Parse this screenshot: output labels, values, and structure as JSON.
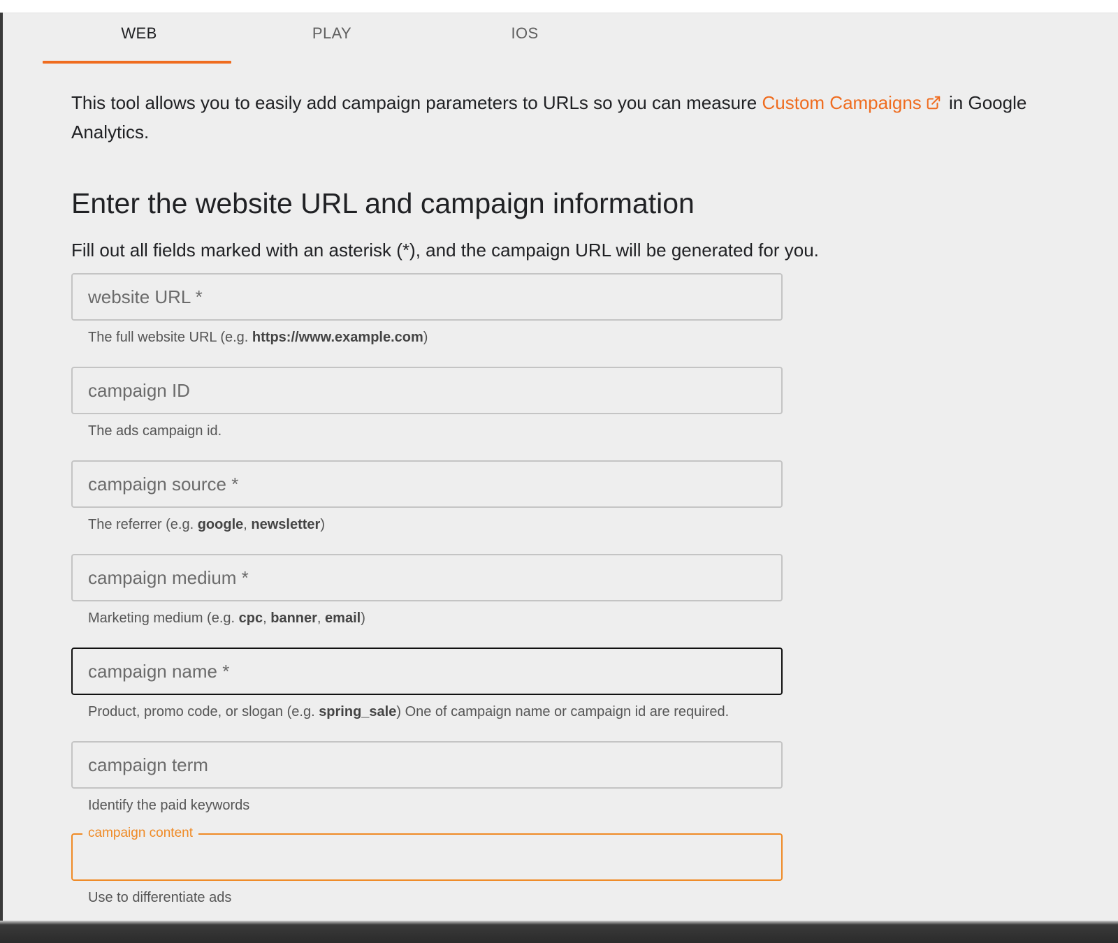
{
  "tabs": [
    {
      "label": "WEB",
      "active": true
    },
    {
      "label": "PLAY",
      "active": false
    },
    {
      "label": "IOS",
      "active": false
    }
  ],
  "intro": {
    "text_before": "This tool allows you to easily add campaign parameters to URLs so you can measure ",
    "link_text": "Custom Campaigns",
    "link_icon": "external-link-icon",
    "text_after": " in Google Analytics."
  },
  "heading": "Enter the website URL and campaign information",
  "subheading": "Fill out all fields marked with an asterisk (*), and the campaign URL will be generated for you.",
  "fields": {
    "website_url": {
      "placeholder": "website URL *",
      "value": "",
      "help_pre": "The full website URL (e.g. ",
      "help_bold": "https://www.example.com",
      "help_post": ")"
    },
    "campaign_id": {
      "placeholder": "campaign ID",
      "value": "",
      "help": "The ads campaign id."
    },
    "campaign_source": {
      "placeholder": "campaign source *",
      "value": "",
      "help_pre": "The referrer (e.g. ",
      "help_bold1": "google",
      "help_sep1": ", ",
      "help_bold2": "newsletter",
      "help_post": ")"
    },
    "campaign_medium": {
      "placeholder": "campaign medium *",
      "value": "",
      "help_pre": "Marketing medium (e.g. ",
      "help_bold1": "cpc",
      "help_sep1": ", ",
      "help_bold2": "banner",
      "help_sep2": ", ",
      "help_bold3": "email",
      "help_post": ")"
    },
    "campaign_name": {
      "placeholder": "campaign name *",
      "value": "",
      "help_pre": "Product, promo code, or slogan (e.g. ",
      "help_bold": "spring_sale",
      "help_post": ") One of campaign name or campaign id are required."
    },
    "campaign_term": {
      "placeholder": "campaign term",
      "value": "",
      "help": "Identify the paid keywords"
    },
    "campaign_content": {
      "label": "campaign content",
      "value": "",
      "help": "Use to differentiate ads"
    }
  },
  "colors": {
    "accent": "#ef6c1f",
    "focus_orange": "#ef8a25",
    "background": "#eeeeee"
  }
}
